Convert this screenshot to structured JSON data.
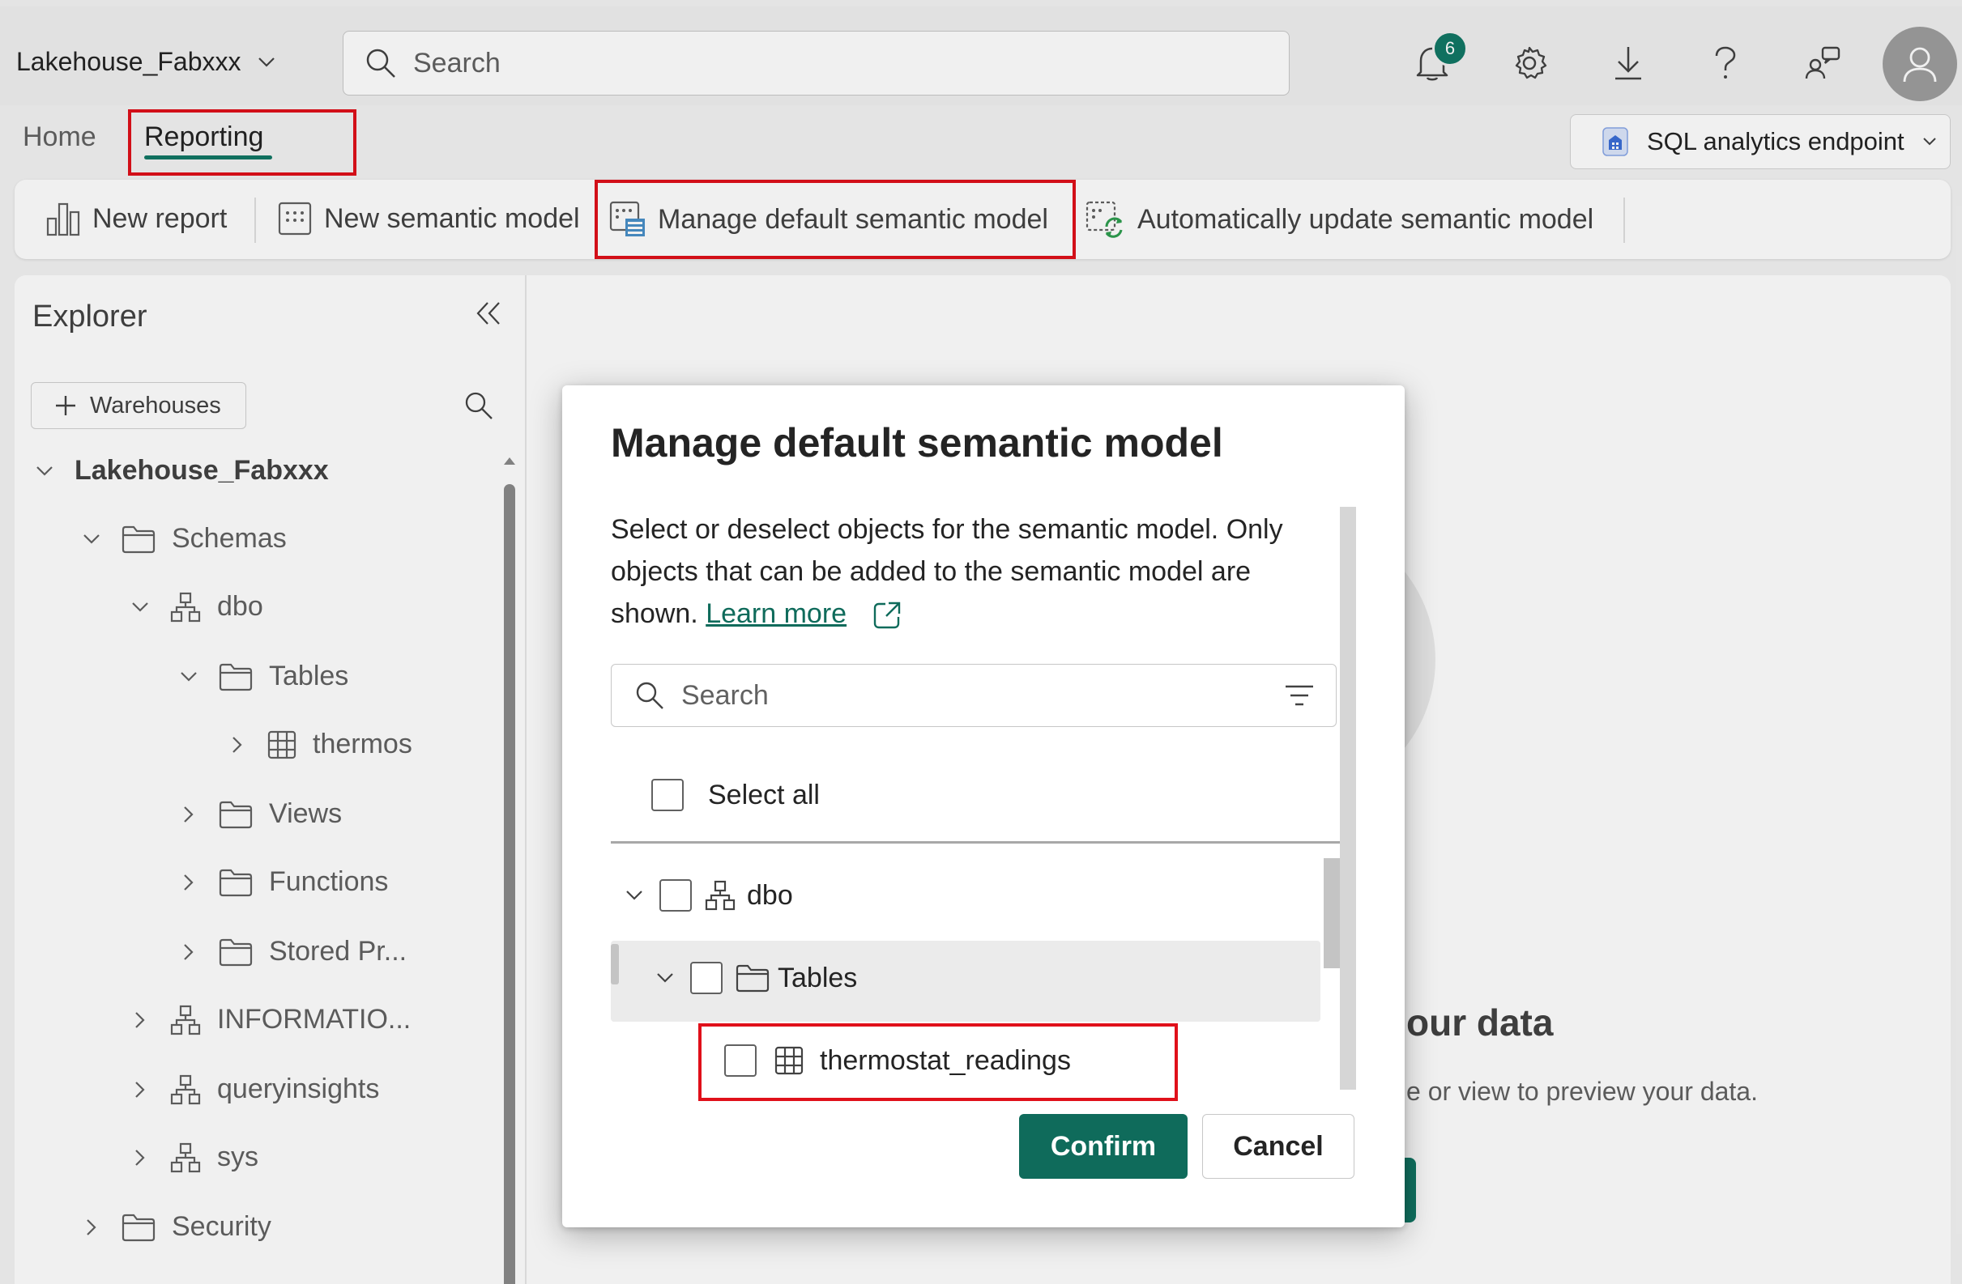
{
  "topbar": {
    "workspace_name": "Lakehouse_Fabxxx",
    "search_placeholder": "Search",
    "notification_count": "6"
  },
  "ribbon": {
    "tabs": [
      "Home",
      "Reporting"
    ],
    "active_tab": "Reporting",
    "endpoint_label": "SQL analytics endpoint"
  },
  "toolbar": {
    "new_report": "New report",
    "new_semantic_model": "New semantic model",
    "manage_default_semantic_model": "Manage default semantic model",
    "auto_update_semantic_model": "Automatically update semantic model"
  },
  "explorer": {
    "title": "Explorer",
    "add_button": "Warehouses",
    "tree": [
      {
        "label": "Lakehouse_Fabxxx",
        "icon": "none",
        "expanded": true
      },
      {
        "label": "Schemas",
        "icon": "folder-icon",
        "expanded": true
      },
      {
        "label": "dbo",
        "icon": "schema-icon",
        "expanded": true
      },
      {
        "label": "Tables",
        "icon": "folder-icon",
        "expanded": true
      },
      {
        "label": "thermos",
        "icon": "table-icon",
        "expanded": false
      },
      {
        "label": "Views",
        "icon": "folder-icon",
        "expanded": false
      },
      {
        "label": "Functions",
        "icon": "folder-icon",
        "expanded": false
      },
      {
        "label": "Stored Pr...",
        "icon": "folder-icon",
        "expanded": false
      },
      {
        "label": "INFORMATIO...",
        "icon": "schema-icon",
        "expanded": false
      },
      {
        "label": "queryinsights",
        "icon": "schema-icon",
        "expanded": false
      },
      {
        "label": "sys",
        "icon": "schema-icon",
        "expanded": false
      },
      {
        "label": "Security",
        "icon": "folder-icon",
        "expanded": false
      }
    ]
  },
  "background": {
    "heading": "our data",
    "subtext": "e or view to preview your data."
  },
  "dialog": {
    "title": "Manage default semantic model",
    "description": "Select or deselect objects for the semantic model. Only objects that can be added to the semantic model are shown.",
    "learn_more": "Learn more",
    "search_placeholder": "Search",
    "select_all": "Select all",
    "tree": {
      "schema": "dbo",
      "folder": "Tables",
      "table": "thermostat_readings"
    },
    "confirm": "Confirm",
    "cancel": "Cancel"
  },
  "colors": {
    "accent": "#117865",
    "highlight_border": "#e0101a"
  }
}
